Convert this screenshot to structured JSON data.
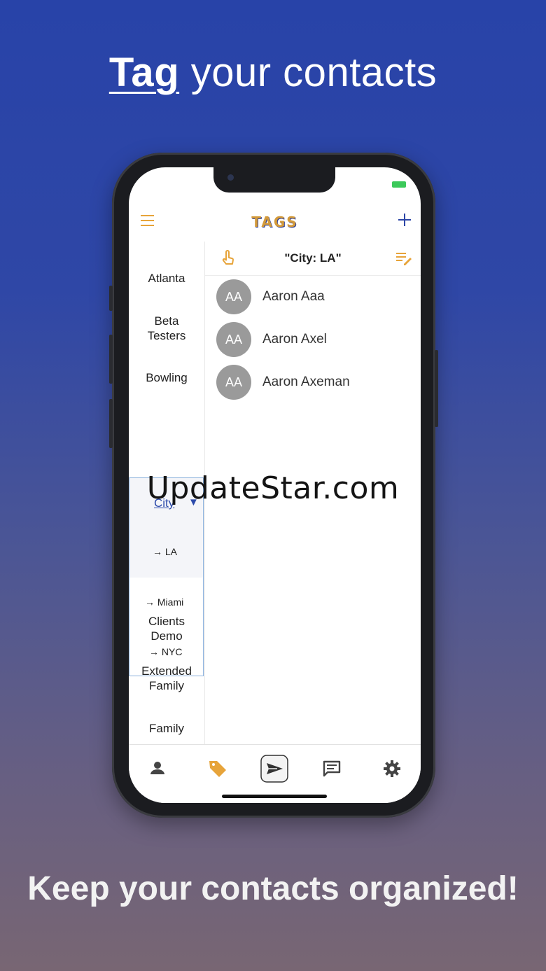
{
  "headline": {
    "emphasis": "Tag",
    "rest": " your contacts"
  },
  "footer": {
    "text": "Keep your contacts organized!"
  },
  "app": {
    "title": "TAGS",
    "header_icons": [
      "menu-icon",
      "plus-icon"
    ]
  },
  "sidebar": {
    "items": [
      {
        "label": "Atlanta"
      },
      {
        "label": "Beta\nTesters"
      },
      {
        "label": "Bowling"
      },
      {
        "label": "Clients\nDemo"
      },
      {
        "label": "Extended\nFamily"
      },
      {
        "label": "Family"
      }
    ],
    "expanded": {
      "label": "City",
      "caret": "▼",
      "children": [
        "→ LA",
        "→ Miami",
        "→ NYC"
      ]
    }
  },
  "filter": {
    "title": "\"City: LA\""
  },
  "contacts": [
    {
      "initials": "AA",
      "name": "Aaron Aaa"
    },
    {
      "initials": "AA",
      "name": "Aaron Axel"
    },
    {
      "initials": "AA",
      "name": "Aaron Axeman"
    }
  ],
  "bottom_tabs": [
    "person-icon",
    "tag-icon",
    "send-icon",
    "message-icon",
    "gear-icon"
  ],
  "colors": {
    "accent_orange": "#e7a43a",
    "accent_blue": "#2c45a6",
    "avatar_gray": "#9a9a9a"
  },
  "watermark": "UpdateStar.com"
}
